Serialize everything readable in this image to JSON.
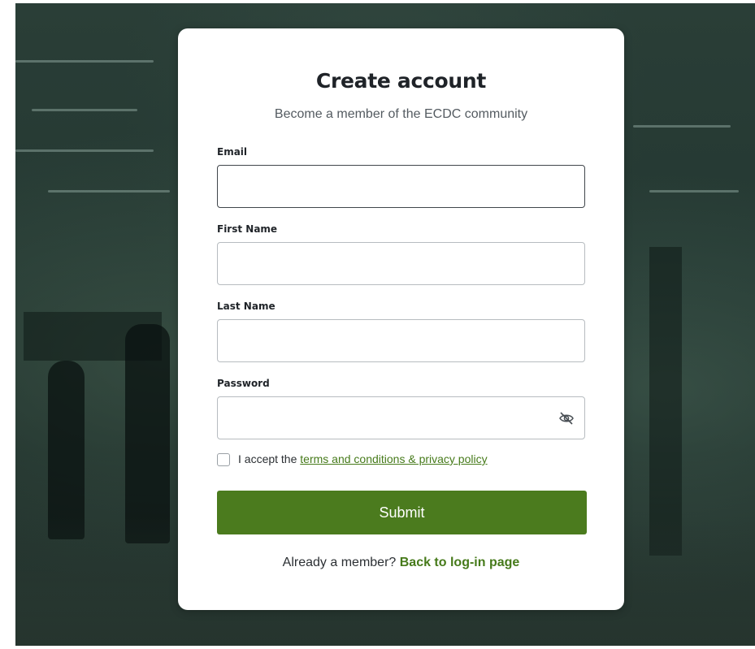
{
  "form": {
    "title": "Create account",
    "subtitle": "Become a member of the ECDC community",
    "email_label": "Email",
    "email_value": "",
    "first_name_label": "First Name",
    "first_name_value": "",
    "last_name_label": "Last Name",
    "last_name_value": "",
    "password_label": "Password",
    "password_value": "",
    "password_toggle_icon": "eye-slash-icon",
    "terms_prefix": "I accept the ",
    "terms_link": "terms and conditions & privacy policy",
    "terms_checked": false,
    "submit_label": "Submit",
    "footer_prefix": "Already a member? ",
    "footer_link": "Back to log-in page"
  },
  "colors": {
    "accent": "#4b7b1e",
    "link": "#467a1a",
    "background_overlay": "#243832"
  }
}
